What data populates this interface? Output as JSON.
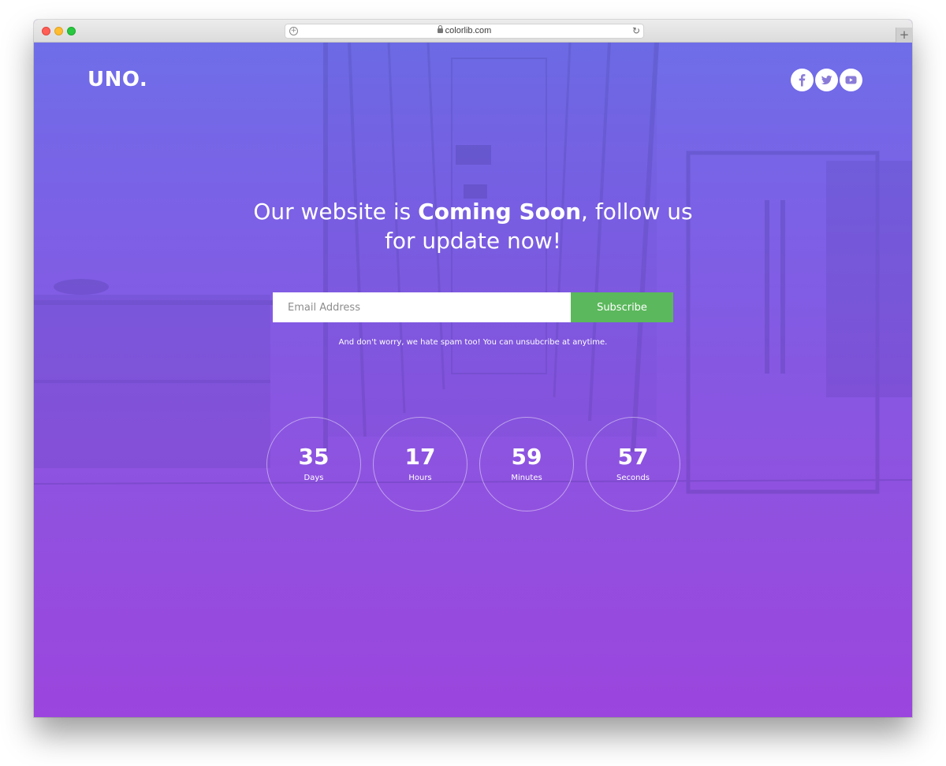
{
  "browser": {
    "url": "colorlib.com",
    "icons": [
      "site-info-icon",
      "lock-icon",
      "reload-icon",
      "plus-icon"
    ]
  },
  "brand": {
    "logo": "UNO."
  },
  "social": {
    "icons": [
      "facebook-icon",
      "twitter-icon",
      "youtube-icon"
    ],
    "icon_color": "#8a7bd8"
  },
  "hero": {
    "headline_pre": "Our website is ",
    "headline_bold": "Coming Soon",
    "headline_post": ", follow us for update now!"
  },
  "subscribe": {
    "email_placeholder": "Email Address",
    "button_label": "Subscribe",
    "button_color": "#5bb85c",
    "note": "And don't worry, we hate spam too! You can unsubcribe at anytime."
  },
  "countdown": [
    {
      "value": "35",
      "unit": "Days"
    },
    {
      "value": "17",
      "unit": "Hours"
    },
    {
      "value": "59",
      "unit": "Minutes"
    },
    {
      "value": "57",
      "unit": "Seconds"
    }
  ],
  "colors": {
    "gradient_top": "#6f6ee8",
    "gradient_bottom": "#9b45de"
  }
}
